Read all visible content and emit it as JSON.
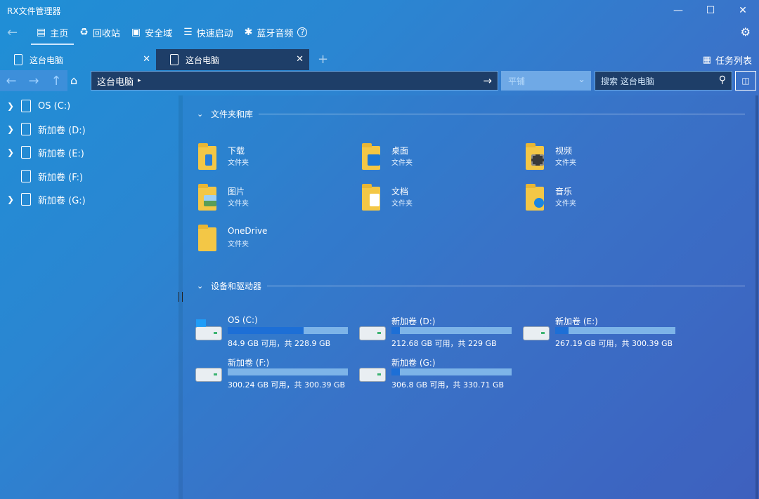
{
  "app": {
    "title": "RX文件管理器"
  },
  "menu": {
    "items": [
      {
        "label": "主页",
        "icon": "home-window-icon",
        "active": true
      },
      {
        "label": "回收站",
        "icon": "recycle-icon"
      },
      {
        "label": "安全域",
        "icon": "safe-icon"
      },
      {
        "label": "快速启动",
        "icon": "list-icon"
      },
      {
        "label": "蓝牙音频",
        "icon": "bluetooth-icon"
      }
    ]
  },
  "tabs": [
    {
      "label": "这台电脑"
    },
    {
      "label": "这台电脑"
    }
  ],
  "tasklist": {
    "label": "任务列表"
  },
  "nav": {
    "address": "这台电脑",
    "layout": "平铺",
    "search_placeholder": "搜索 这台电脑"
  },
  "sidebar": {
    "items": [
      {
        "label": "OS (C:)",
        "expandable": true
      },
      {
        "label": "新加卷 (D:)",
        "expandable": true
      },
      {
        "label": "新加卷 (E:)",
        "expandable": true
      },
      {
        "label": "新加卷 (F:)",
        "expandable": false
      },
      {
        "label": "新加卷 (G:)",
        "expandable": true
      }
    ]
  },
  "sections": {
    "libraries": "文件夹和库",
    "drives": "设备和驱动器"
  },
  "folders": [
    {
      "name": "下载",
      "type": "文件夹"
    },
    {
      "name": "桌面",
      "type": "文件夹"
    },
    {
      "name": "视频",
      "type": "文件夹"
    },
    {
      "name": "图片",
      "type": "文件夹"
    },
    {
      "name": "文档",
      "type": "文件夹"
    },
    {
      "name": "音乐",
      "type": "文件夹"
    },
    {
      "name": "OneDrive",
      "type": "文件夹"
    }
  ],
  "drives": [
    {
      "name": "OS (C:)",
      "size": "84.9 GB 可用，共 228.9 GB",
      "used_fraction": 0.63
    },
    {
      "name": "新加卷 (D:)",
      "size": "212.68 GB 可用，共 229 GB",
      "used_fraction": 0.07
    },
    {
      "name": "新加卷 (E:)",
      "size": "267.19 GB 可用，共 300.39 GB",
      "used_fraction": 0.11
    },
    {
      "name": "新加卷 (F:)",
      "size": "300.24 GB 可用，共 300.39 GB",
      "used_fraction": 0.0
    },
    {
      "name": "新加卷 (G:)",
      "size": "306.8 GB 可用，共 330.71 GB",
      "used_fraction": 0.07
    }
  ]
}
